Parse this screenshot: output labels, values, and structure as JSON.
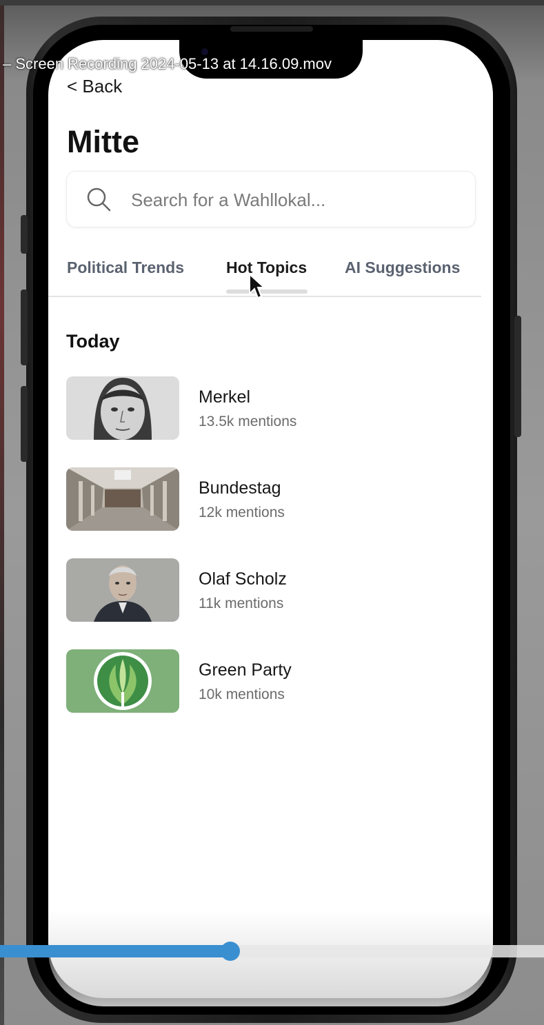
{
  "video": {
    "title": "– Screen Recording 2024-05-13 at 14.16.09.mov",
    "progress": 0.42
  },
  "header": {
    "back_label": "< Back",
    "title": "Mitte"
  },
  "search": {
    "placeholder": "Search for a Wahllokal..."
  },
  "tabs": [
    {
      "label": "Political Trends",
      "active": false
    },
    {
      "label": "Hot Topics",
      "active": true
    },
    {
      "label": "AI Suggestions",
      "active": false
    }
  ],
  "section": {
    "title": "Today"
  },
  "topics": [
    {
      "name": "Merkel",
      "mentions": "13.5k mentions"
    },
    {
      "name": "Bundestag",
      "mentions": "12k mentions"
    },
    {
      "name": "Olaf Scholz",
      "mentions": "11k mentions"
    },
    {
      "name": "Green Party",
      "mentions": "10k mentions"
    }
  ],
  "colors": {
    "accent": "#3a8fd0",
    "green_party": "#7fb07a"
  }
}
